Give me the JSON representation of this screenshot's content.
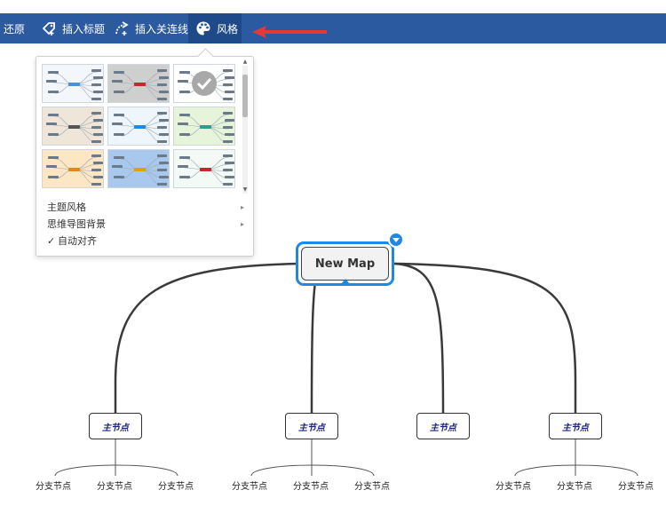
{
  "toolbar": {
    "undo_label": "还原",
    "insert_topic_label": "插入标题",
    "insert_relation_label": "插入关连线",
    "style_label": "风格"
  },
  "dropdown": {
    "menu": [
      {
        "label": "主题风格",
        "has_submenu": true
      },
      {
        "label": "思维导图背景",
        "has_submenu": true
      },
      {
        "label": "自动对齐",
        "checked": true
      }
    ],
    "thumbnails": [
      {
        "name": "theme-1",
        "bg": "#f3f6fb",
        "accent": "#4a90d9"
      },
      {
        "name": "theme-2",
        "bg": "#cfcfcf",
        "accent": "#c62828"
      },
      {
        "name": "theme-3",
        "bg": "#ffffff",
        "accent": "#1e88e5",
        "selected": true
      },
      {
        "name": "theme-4",
        "bg": "#efe5d8",
        "accent": "#555555"
      },
      {
        "name": "theme-5",
        "bg": "#eef6fb",
        "accent": "#1e88e5"
      },
      {
        "name": "theme-6",
        "bg": "#e6f5d9",
        "accent": "#2e9c8f"
      },
      {
        "name": "theme-7",
        "bg": "#fde6c4",
        "accent": "#e08a1e"
      },
      {
        "name": "theme-8",
        "bg": "#a9c8ee",
        "accent": "#d9a500"
      },
      {
        "name": "theme-9",
        "bg": "#f3faf5",
        "accent": "#c62828"
      }
    ]
  },
  "mindmap": {
    "root": "New Map",
    "main_nodes": [
      "主节点",
      "主节点",
      "主节点",
      "主节点"
    ],
    "branch_nodes": [
      "分支节点",
      "分支节点",
      "分支节点",
      "分支节点",
      "分支节点",
      "分支节点",
      "分支节点",
      "分支节点",
      "分支节点"
    ]
  },
  "colors": {
    "toolbar_bg": "#2c5aa0",
    "selection_blue": "#1e88e5",
    "annotation_red": "#e53935"
  }
}
